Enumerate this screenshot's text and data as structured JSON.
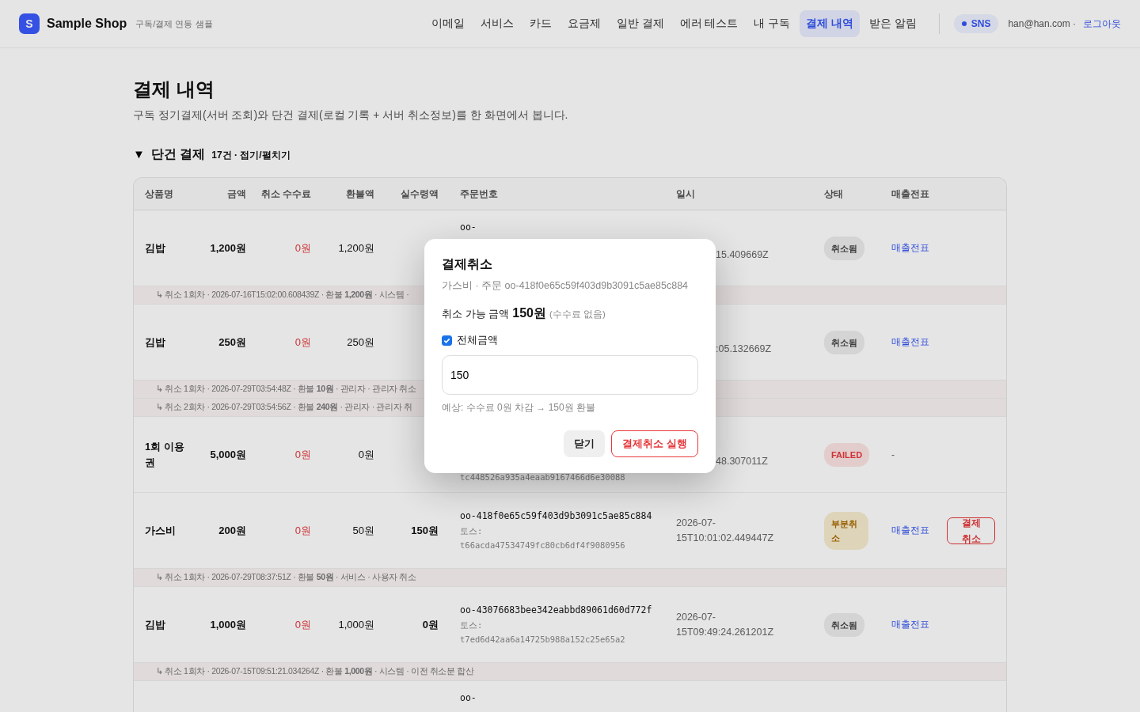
{
  "header": {
    "logo": "S",
    "brand": "Sample Shop",
    "tagline": "구독/결제 연동 샘플",
    "nav": [
      {
        "label": "이메일",
        "selected": false
      },
      {
        "label": "서비스",
        "selected": false
      },
      {
        "label": "카드",
        "selected": false
      },
      {
        "label": "요금제",
        "selected": false
      },
      {
        "label": "일반 결제",
        "selected": false
      },
      {
        "label": "에러 테스트",
        "selected": false
      },
      {
        "label": "내 구독",
        "selected": false
      },
      {
        "label": "결제 내역",
        "selected": true
      },
      {
        "label": "받은 알림",
        "selected": false
      }
    ],
    "login_badge": "SNS",
    "email": "han@han.com ·",
    "logout": "로그아웃"
  },
  "page": {
    "title": "결제 내역",
    "description": "구독 정기결제(서버 조회)와 단건 결제(로컬 기록 + 서버 취소정보)를 한 화면에서 봅니다.",
    "section": {
      "toggle": "▼",
      "title": "단건 결제",
      "meta": "17건 · 접기/펼치기",
      "expanded": true
    }
  },
  "table": {
    "columns": [
      "상품명",
      "금액",
      "취소 수수료",
      "환불액",
      "실수령액",
      "주문번호",
      "일시",
      "상태",
      "매출전표"
    ],
    "rows": [
      {
        "name": "김밥",
        "amount": "1,200원",
        "fee": "0원",
        "refund": "1,200원",
        "order_no": "oo-",
        "date_tail": "15.409669Z",
        "status": {
          "label": "취소됨",
          "kind": "cancelled"
        },
        "receipt": {
          "label": "매출전표",
          "kind": "link"
        },
        "cancellations": [
          "↳ 취소 1회차 · 2026-07-16T15:02:00.608439Z · 환불 **1,200원** · 시스템 ·"
        ]
      },
      {
        "name": "김밥",
        "amount": "250원",
        "fee": "0원",
        "refund": "250원",
        "date_tail": ":05.132669Z",
        "status": {
          "label": "취소됨",
          "kind": "cancelled"
        },
        "receipt": {
          "label": "매출전표",
          "kind": "link"
        },
        "cancellations": [
          "↳ 취소 1회차 · 2026-07-29T03:54:48Z · 환불 **10원** · 관리자 · 관리자 취소",
          "↳ 취소 2회차 · 2026-07-29T03:54:56Z · 환불 **240원** · 관리자 · 관리자 취"
        ]
      },
      {
        "name": "1회 이용권",
        "amount": "5,000원",
        "fee": "0원",
        "refund": "0원",
        "toss_id": "tc448526a935a4eaab9167466d6e30088",
        "date_tail": "48.307011Z",
        "status": {
          "label": "FAILED",
          "kind": "failed"
        },
        "receipt": {
          "label": "-",
          "kind": "none"
        }
      },
      {
        "name": "가스비",
        "amount": "200원",
        "fee": "0원",
        "refund": "50원",
        "net": "150원",
        "order_no": "oo-418f0e65c59f403d9b3091c5ae85c884",
        "toss_label": "토스:",
        "toss_id": "t66acda47534749fc80cb6df4f9080956",
        "date": "2026-07-15T10:01:02.449447Z",
        "status": {
          "label": "부분취소",
          "kind": "partial"
        },
        "receipt": {
          "label": "매출전표",
          "kind": "link"
        },
        "action": "결제 취소",
        "cancellations": [
          "↳ 취소 1회차 · 2026-07-29T08:37:51Z · 환불 **50원** · 서비스 · 사용자 취소"
        ]
      },
      {
        "name": "김밥",
        "amount": "1,000원",
        "fee": "0원",
        "refund": "1,000원",
        "net": "0원",
        "order_no": "oo-43076683bee342eabbd89061d60d772f",
        "toss_label": "토스:",
        "toss_id": "t7ed6d42aa6a14725b988a152c25e65a2",
        "date": "2026-07-15T09:49:24.261201Z",
        "status": {
          "label": "취소됨",
          "kind": "cancelled"
        },
        "receipt": {
          "label": "매출전표",
          "kind": "link"
        },
        "cancellations": [
          "↳ 취소 1회차 · 2026-07-15T09:51:21.034264Z · 환불 **1,000원** · 시스템 · 이전 취소분 합산"
        ]
      },
      {
        "order_no": "oo-"
      }
    ]
  },
  "dialog": {
    "title": "결제취소",
    "subtitle": "가스비 · 주문 oo-418f0e65c59f403d9b3091c5ae85c884",
    "available_label": "취소 가능 금액",
    "available_amount": "150원",
    "available_note": "(수수료 없음)",
    "full_amount": {
      "label": "전체금액",
      "checked": true
    },
    "amount_value": "150",
    "estimate": "예상: 수수료 0원 차감 → 150원 환불",
    "buttons": [
      {
        "label": "닫기",
        "kind": "secondary"
      },
      {
        "label": "결제취소 실행",
        "kind": "danger"
      }
    ]
  }
}
